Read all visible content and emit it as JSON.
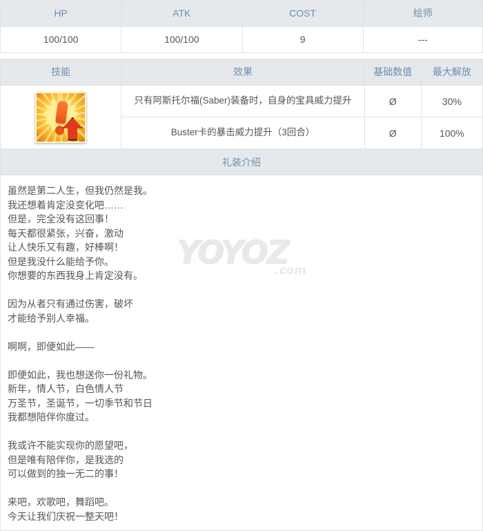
{
  "stats_table": {
    "headers": [
      "HP",
      "ATK",
      "COST",
      "绘师"
    ],
    "row": [
      "100/100",
      "100/100",
      "9",
      "---"
    ]
  },
  "skills_table": {
    "headers": [
      "技能",
      "效果",
      "基础数值",
      "最大解放"
    ],
    "icon_name": "skill-icon-exclamation-up",
    "rows": [
      {
        "effect": "只有阿斯托尔福(Saber)装备时，自身的宝具威力提升",
        "base": "Ø",
        "max": "30%"
      },
      {
        "effect": "Buster卡的暴击威力提升（3回合）",
        "base": "Ø",
        "max": "100%"
      }
    ]
  },
  "intro": {
    "title": "礼装介绍",
    "lines": [
      "虽然是第二人生，但我仍然是我。",
      "我还想着肯定没变化吧……",
      "但是，完全没有这回事！",
      "每天都很紧张，兴奋，激动",
      "让人快乐又有趣，好棒啊！",
      "但是我没什么能给予你。",
      "你想要的东西我身上肯定没有。",
      "",
      "因为从者只有通过伤害，破坏",
      "才能给予别人幸福。",
      "",
      "啊啊，即便如此——",
      "",
      "即便如此，我也想送你一份礼物。",
      "新年，情人节，白色情人节",
      "万圣节，圣诞节，一切季节和节日",
      "我都想陪伴你度过。",
      "",
      "我或许不能实现你的愿望吧，",
      "但是唯有陪伴你，是我选的",
      "可以做到的独一无二的事！",
      "",
      "来吧，欢歌吧，舞蹈吧。",
      "今天让我们庆祝一整天吧！"
    ]
  },
  "watermark": {
    "text": "YOYOZ",
    "domain": ".com"
  },
  "colors": {
    "header_bg": "#e6e9eb",
    "header_text": "#6d8cb0",
    "border": "#e0e3e6",
    "body_text": "#555555"
  }
}
